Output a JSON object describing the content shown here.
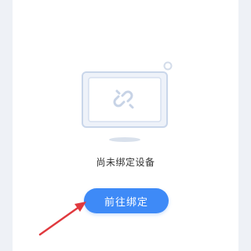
{
  "empty_state": {
    "message": "尚未绑定设备",
    "illustration_icon": "monitor-broken-link-icon"
  },
  "actions": {
    "go_bind_label": "前往绑定"
  },
  "annotation": {
    "icon": "red-arrow-icon",
    "color": "#e0393e"
  },
  "colors": {
    "accent": "#3e8af7",
    "background": "#eef1f6",
    "card": "#ffffff",
    "text": "#333333"
  }
}
